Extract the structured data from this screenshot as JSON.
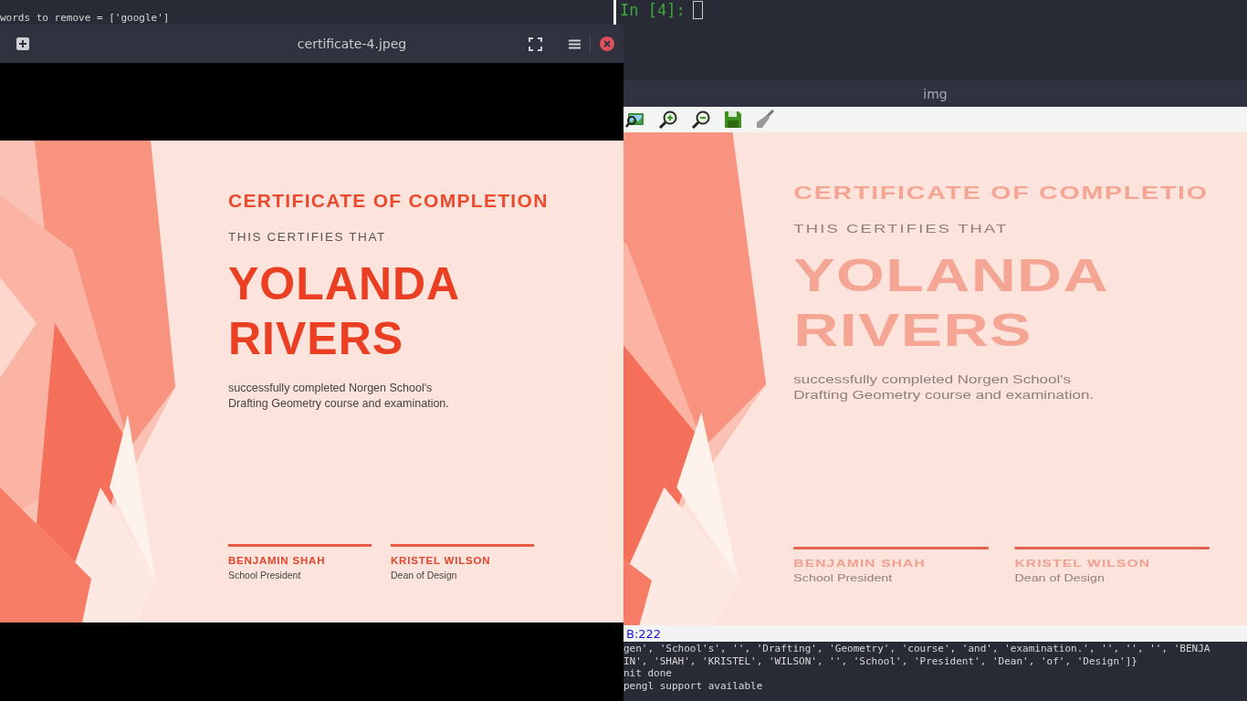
{
  "terminal_left": {
    "lines": [
      "words to remove = ['google']"
    ]
  },
  "terminal_right": {
    "prompt": "In [4]:"
  },
  "viewer": {
    "title": "certificate-4.jpeg",
    "certificate": {
      "heading": "CERTIFICATE OF COMPLETION",
      "subheading": "THIS CERTIFIES THAT",
      "name_lines": [
        "YOLANDA",
        "RIVERS"
      ],
      "body_lines": [
        "successfully completed Norgen School's",
        "Drafting Geometry course and examination."
      ],
      "signatories": [
        {
          "name": "BENJAMIN SHAH",
          "role": "School President"
        },
        {
          "name": "KRISTEL WILSON",
          "role": "Dean of Design"
        }
      ]
    }
  },
  "img_window": {
    "title": "img",
    "certificate": {
      "heading": "CERTIFICATE OF COMPLETIO",
      "subheading": "THIS CERTIFIES THAT",
      "name_lines": [
        "YOLANDA",
        "RIVERS"
      ],
      "body_lines": [
        "successfully completed Norgen School's",
        "Drafting Geometry course and examination."
      ],
      "signatories": [
        {
          "name": "BENJAMIN SHAH",
          "role": "School President"
        },
        {
          "name": "KRISTEL WILSON",
          "role": "Dean of Design"
        }
      ]
    },
    "status": "B:222"
  },
  "terminal_bottom": {
    "lines": [
      "gen', 'School's', '', 'Drafting', 'Geometry', 'course', 'and', 'examination.', '', '', '', 'BENJA",
      "IN', 'SHAH', 'KRISTEL', 'WILSON', '', 'School', 'President', 'Dean', 'of', 'Design']}",
      "nit done",
      "pengl support available"
    ]
  }
}
